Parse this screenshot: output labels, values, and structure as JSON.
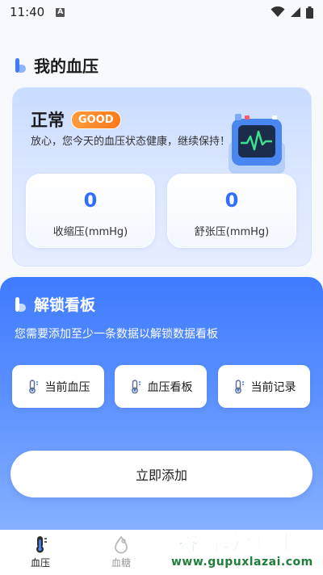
{
  "status_bar": {
    "time": "11:40",
    "notif": "A"
  },
  "header": {
    "title": "我的血压"
  },
  "status_card": {
    "status": "正常",
    "badge": "GOOD",
    "description": "放心，您今天的血压状态健康，继续保持！",
    "systolic": {
      "value": "0",
      "label": "收缩压(mmHg)"
    },
    "diastolic": {
      "value": "0",
      "label": "舒张压(mmHg)"
    }
  },
  "unlock": {
    "title": "解锁看板",
    "description": "您需要添加至少一条数据以解锁数据看板",
    "chips": [
      {
        "label": "当前血压",
        "icon": "thermometer-icon"
      },
      {
        "label": "血压看板",
        "icon": "thermometer-icon"
      },
      {
        "label": "当前记录",
        "icon": "thermometer-icon"
      }
    ],
    "add_button": "立即添加"
  },
  "tabs": [
    {
      "label": "血压",
      "icon": "thermometer-icon",
      "active": true
    },
    {
      "label": "血糖",
      "icon": "blood-drop-icon",
      "active": false
    }
  ],
  "watermark": {
    "top": "谷普软件园",
    "bottom": "www.gupuxlazai.com"
  },
  "colors": {
    "accent": "#3f7bff",
    "badge": "#ff8a2a",
    "value": "#2f6dff",
    "watermark": "#2aa34a"
  }
}
